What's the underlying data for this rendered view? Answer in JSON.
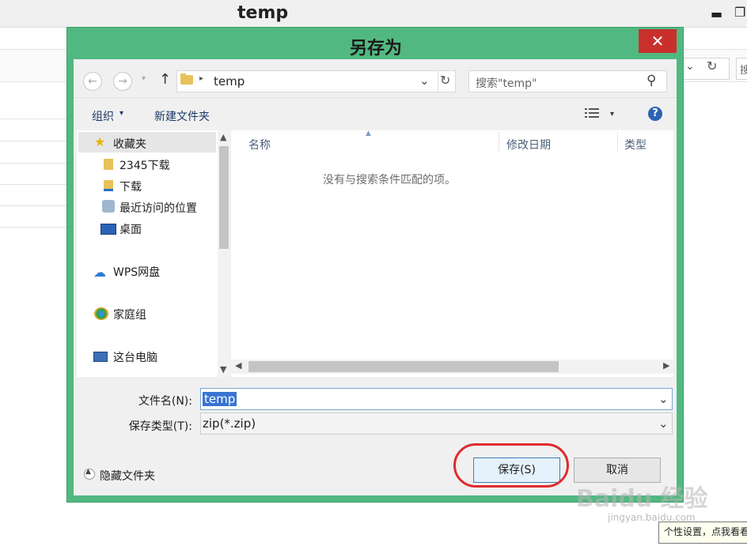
{
  "background_window": {
    "title": "temp",
    "minimize_glyph": "▬",
    "restore_glyph": "❐",
    "dropdown_glyph": "⌄",
    "refresh_glyph": "↻",
    "search_stub": "搜"
  },
  "dialog": {
    "title": "另存为",
    "close_glyph": "✕",
    "nav": {
      "back_glyph": "←",
      "forward_glyph": "→",
      "recent_glyph": "▾",
      "up_glyph": "↑",
      "path_separator": "▸",
      "path": "temp",
      "path_dropdown_glyph": "⌄",
      "refresh_glyph": "↻",
      "search_placeholder": "搜索\"temp\"",
      "search_glyph": "⚲"
    },
    "commands": {
      "organize": "组织",
      "organize_arrow": "▾",
      "new_folder": "新建文件夹",
      "view_arrow": "▾",
      "help_glyph": "?"
    },
    "navigation_pane": {
      "favorites": {
        "label": "收藏夹",
        "icon": "star-icon"
      },
      "items": [
        {
          "label": "2345下载",
          "icon": "folder-icon"
        },
        {
          "label": "下载",
          "icon": "download-folder-icon"
        },
        {
          "label": "最近访问的位置",
          "icon": "recent-places-icon"
        },
        {
          "label": "桌面",
          "icon": "desktop-icon"
        }
      ],
      "wps": {
        "label": "WPS网盘",
        "icon": "cloud-icon"
      },
      "homegroup": {
        "label": "家庭组",
        "icon": "homegroup-icon"
      },
      "this_pc": {
        "label": "这台电脑",
        "icon": "computer-icon"
      },
      "scroll_up": "▲",
      "scroll_down": "▼"
    },
    "file_list": {
      "columns": [
        "名称",
        "修改日期",
        "类型"
      ],
      "sort_glyph": "▲",
      "empty_message": "没有与搜索条件匹配的项。",
      "scroll_left": "◀",
      "scroll_right": "▶"
    },
    "form": {
      "filename_label": "文件名(N):",
      "filename_value": "temp",
      "filetype_label": "保存类型(T):",
      "filetype_value": "zip(*.zip)",
      "dropdown_glyph": "⌄"
    },
    "hide_folders": {
      "label": "隐藏文件夹",
      "glyph": "▲"
    },
    "buttons": {
      "save": "保存(S)",
      "cancel": "取消"
    }
  },
  "overlay": {
    "watermark_logo": "Baidu 经验",
    "watermark_url": "jingyan.baidu.com",
    "tooltip": "个性设置，点我看看"
  },
  "colors": {
    "dialog_frame": "#52b881",
    "close_button": "#c9302c",
    "selection": "#3874d1",
    "annotation_ring": "#e02b2b",
    "link_text": "#1d3a66"
  }
}
